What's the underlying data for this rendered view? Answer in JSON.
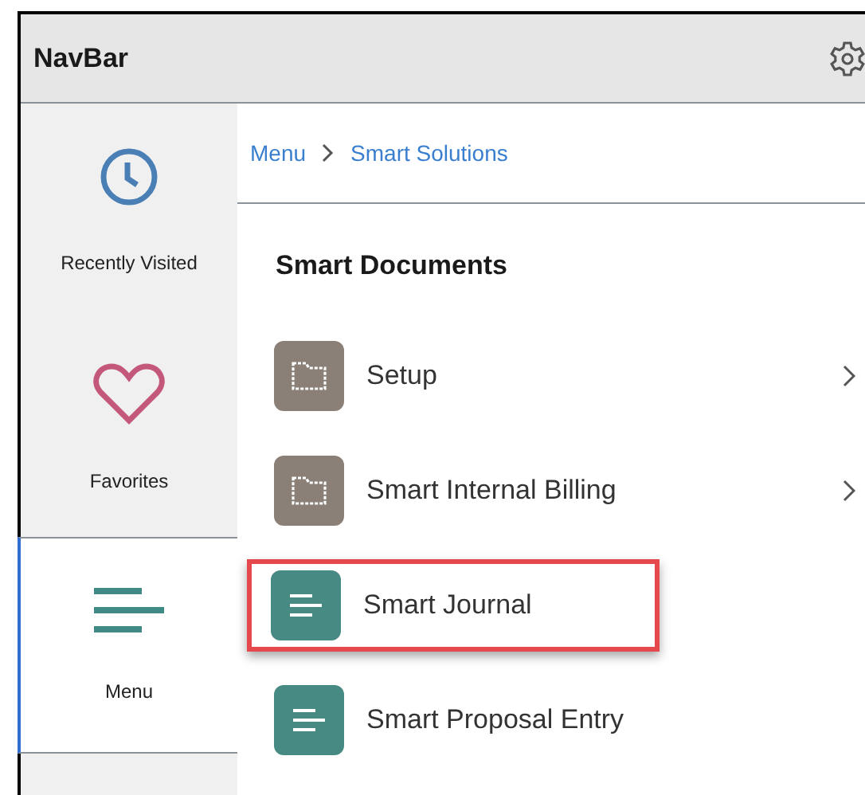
{
  "header": {
    "title": "NavBar"
  },
  "sidebar": {
    "items": [
      {
        "kind": "clock",
        "label": "Recently Visited",
        "selected": false
      },
      {
        "kind": "heart",
        "label": "Favorites",
        "selected": false
      },
      {
        "kind": "menu",
        "label": "Menu",
        "selected": true
      }
    ]
  },
  "breadcrumb": [
    {
      "label": "Menu"
    },
    {
      "label": "Smart Solutions"
    }
  ],
  "section": {
    "title": "Smart Documents"
  },
  "items": [
    {
      "kind": "folder",
      "label": "Setup",
      "highlighted": false
    },
    {
      "kind": "folder",
      "label": "Smart Internal Billing",
      "highlighted": false
    },
    {
      "kind": "document",
      "label": "Smart Journal",
      "highlighted": true
    },
    {
      "kind": "document",
      "label": "Smart Proposal Entry",
      "highlighted": false
    }
  ]
}
